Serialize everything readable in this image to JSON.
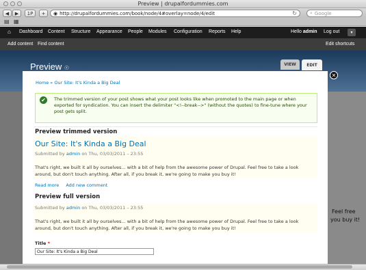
{
  "browser": {
    "window_title": "Preview | drupalfordummies.com",
    "url": "http://drupalfordummies.com/book/node/4#overlay=node/4/edit",
    "search_placeholder": "Google"
  },
  "admin_bar": {
    "home_icon": "home-icon",
    "items": [
      "Dashboard",
      "Content",
      "Structure",
      "Appearance",
      "People",
      "Modules",
      "Configuration",
      "Reports",
      "Help"
    ],
    "hello": "Hello",
    "user": "admin",
    "logout": "Log out"
  },
  "shortcuts": {
    "add_content": "Add content",
    "find_content": "Find content",
    "edit_shortcuts": "Edit shortcuts"
  },
  "overlay": {
    "title": "Preview",
    "tabs": {
      "view": "VIEW",
      "edit": "EDIT"
    },
    "breadcrumb": {
      "home": "Home",
      "sep": "»",
      "crumb": "Our Site: It's Kinda a Big Deal"
    },
    "status_message": "The trimmed version of your post shows what your post looks like when promoted to the main page or when exported for syndication. You can insert the delimiter \"<!--break-->\" (without the quotes) to fine-tune where your post gets split.",
    "trimmed": {
      "heading": "Preview trimmed version",
      "title": "Our Site: It's Kinda a Big Deal",
      "submitted_by": "Submitted by",
      "author": "admin",
      "date": "on Thu, 03/03/2011 – 23:55",
      "body": "That's right, we built it all by ourselves... with a bit of help from the awesome power of Drupal. Feel free to take a look around, but don't touch anything. After all, if you break it, we're going to make you buy it!",
      "read_more": "Read more",
      "add_comment": "Add new comment"
    },
    "full": {
      "heading": "Preview full version",
      "submitted_by": "Submitted by",
      "author": "admin",
      "date": "on Thu, 03/03/2011 – 23:55",
      "body": "That's right, we built it all by ourselves... with a bit of help from the awesome power of Drupal. Feel free to take a look around, but don't touch anything. After all, if you break it, we're going to make you buy it!"
    },
    "form": {
      "title_label": "Title",
      "required": "*",
      "title_value": "Our Site: It's Kinda a Big Deal"
    }
  },
  "background_page": {
    "right_text1": "Feel free",
    "right_text2": "you buy it!"
  },
  "colors": {
    "link": "#0071b3",
    "toolbar": "#1d1d1d",
    "status_bg": "#f8fff0"
  }
}
